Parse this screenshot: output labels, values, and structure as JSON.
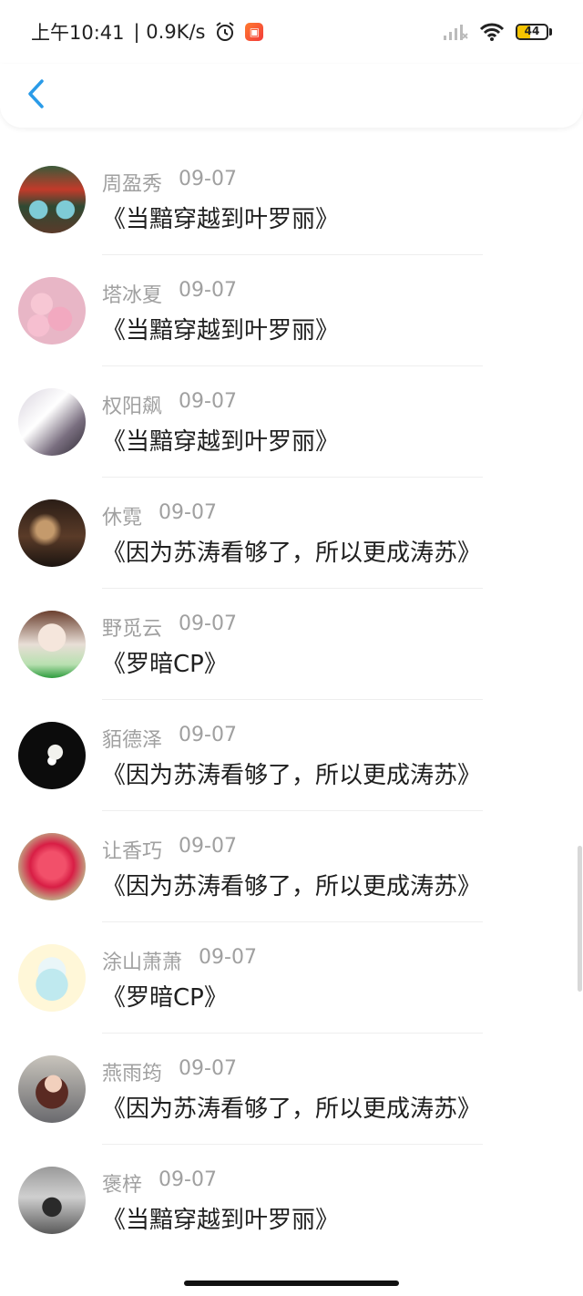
{
  "status_bar": {
    "time": "上午10:41",
    "speed": "| 0.9K/s",
    "battery": "44",
    "battery_level": 0.44,
    "battery_color": "#f5c400",
    "icons": [
      "alarm-icon",
      "app-badge-icon",
      "signal-icon",
      "wifi-icon",
      "battery-icon"
    ]
  },
  "header": {
    "back_icon": "chevron-left-icon",
    "accent": "#2a9be8"
  },
  "comments": [
    {
      "name": "周盈秀",
      "date": "09-07",
      "text": "《当黯穿越到叶罗丽》"
    },
    {
      "name": "塔冰夏",
      "date": "09-07",
      "text": "《当黯穿越到叶罗丽》"
    },
    {
      "name": "权阳飙",
      "date": "09-07",
      "text": "《当黯穿越到叶罗丽》"
    },
    {
      "name": "休霓",
      "date": "09-07",
      "text": "《因为苏涛看够了，所以更成涛苏》"
    },
    {
      "name": "野觅云",
      "date": "09-07",
      "text": "《罗暗CP》"
    },
    {
      "name": "貊德泽",
      "date": "09-07",
      "text": "《因为苏涛看够了，所以更成涛苏》"
    },
    {
      "name": "让香巧",
      "date": "09-07",
      "text": "《因为苏涛看够了，所以更成涛苏》"
    },
    {
      "name": "涂山萧萧",
      "date": "09-07",
      "text": "《罗暗CP》"
    },
    {
      "name": "燕雨筠",
      "date": "09-07",
      "text": "《因为苏涛看够了，所以更成涛苏》"
    },
    {
      "name": "褒梓",
      "date": "09-07",
      "text": "《当黯穿越到叶罗丽》"
    }
  ]
}
